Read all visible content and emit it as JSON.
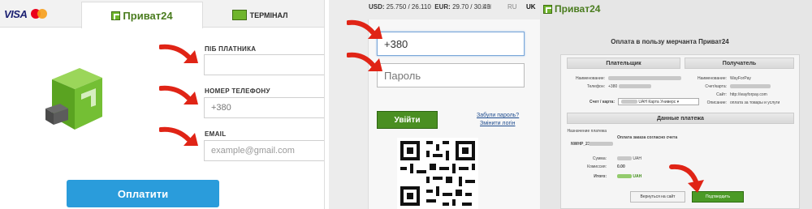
{
  "panel1": {
    "card_brand": "VISA",
    "tabs": {
      "privat24": "Приват24",
      "terminal": "ТЕРМІНАЛ"
    },
    "fields": [
      {
        "label": "ПІБ ПЛАТНИКА",
        "value": ""
      },
      {
        "label": "НОМЕР ТЕЛЕФОНУ",
        "value": "+380"
      },
      {
        "label": "EMAIL",
        "placeholder": "example@gmail.com"
      }
    ],
    "pay_button": "Оплатити",
    "colors": {
      "pay_button": "#2a9cdb",
      "brand_green": "#6fb52c"
    }
  },
  "panel2": {
    "rates": {
      "usd_label": "USD:",
      "usd_value": "25.750 / 26.110",
      "eur_label": "EUR:",
      "eur_value": "29.70 / 30.49"
    },
    "languages": [
      "EN",
      "RU",
      "UK"
    ],
    "phone_value": "+380",
    "password_placeholder": "Пароль",
    "enter_button": "Увійти",
    "forgot_password": "Забули пароль?",
    "change_login": "Змінити логін"
  },
  "panel3": {
    "logo": "Приват24",
    "title": "Оплата в пользу мерчанта Приват24",
    "payer": {
      "heading": "Плательщик",
      "name_label": "Наименование:",
      "phone_label": "Телефон:",
      "phone_value": "+380",
      "account_label": "Счет / карта:",
      "account_value": "UAH Карта Универс"
    },
    "receiver": {
      "heading": "Получатель",
      "name_label": "Наименование:",
      "name_value": "WayForPay",
      "account_label": "Счет/карта:",
      "site_label": "Сайт:",
      "site_value": "http://wayforpay.com",
      "desc_label": "Описание:",
      "desc_value": "оплата за товары и услуги"
    },
    "payment": {
      "heading": "Данные платежа",
      "purpose_label": "Назначение платежа",
      "purpose_value": "Оплата заказа согласно счета",
      "order_value": "NWHP_23974",
      "sum_label": "Сумма:",
      "currency": "UAH",
      "commission_label": "Комиссия:",
      "commission_value": "0.00",
      "total_label": "Итого:"
    },
    "back_button": "Вернуться на сайт",
    "confirm_button": "Подтвердить"
  },
  "arrow_color": "#e02416"
}
